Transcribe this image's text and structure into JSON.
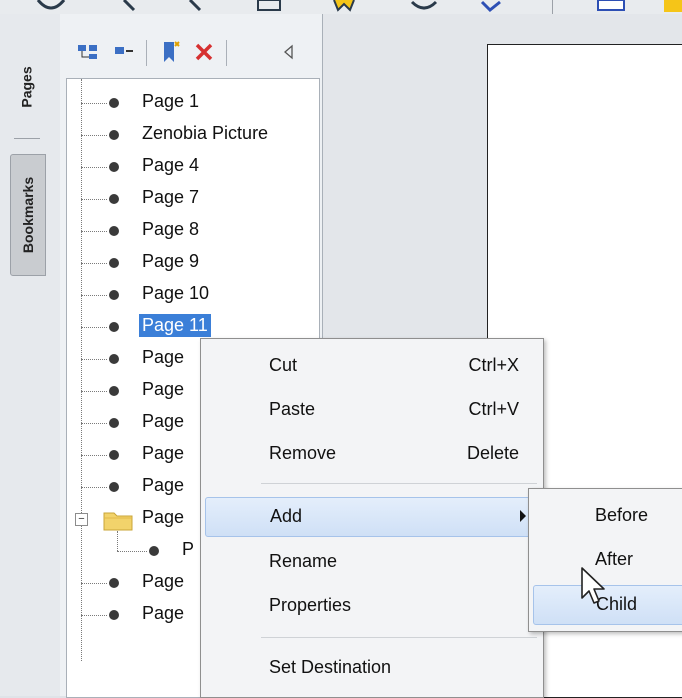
{
  "left_tabs": {
    "pages": "Pages",
    "bookmarks": "Bookmarks"
  },
  "bookmark_tree": {
    "items": [
      {
        "label": "Page 1"
      },
      {
        "label": "Zenobia Picture"
      },
      {
        "label": "Page 4"
      },
      {
        "label": "Page 7"
      },
      {
        "label": "Page 8"
      },
      {
        "label": "Page 9"
      },
      {
        "label": "Page 10"
      },
      {
        "label": "Page 11",
        "selected": true
      },
      {
        "label": "Page"
      },
      {
        "label": "Page"
      },
      {
        "label": "Page"
      },
      {
        "label": "Page"
      },
      {
        "label": "Page"
      },
      {
        "label": "Page",
        "folder": true,
        "expanded": true
      },
      {
        "label": "P",
        "child": true
      },
      {
        "label": "Page"
      },
      {
        "label": "Page"
      }
    ]
  },
  "context_menu": {
    "cut": {
      "label": "Cut",
      "shortcut": "Ctrl+X"
    },
    "paste": {
      "label": "Paste",
      "shortcut": "Ctrl+V"
    },
    "remove": {
      "label": "Remove",
      "shortcut": "Delete"
    },
    "add": {
      "label": "Add"
    },
    "rename": {
      "label": "Rename"
    },
    "properties": {
      "label": "Properties"
    },
    "set_destination": {
      "label": "Set Destination"
    }
  },
  "add_submenu": {
    "before": "Before",
    "after": "After",
    "child": "Child"
  },
  "colors": {
    "selection": "#3b7fd8",
    "menu_highlight": "#cfe0f6",
    "folder": "#f2d36b"
  }
}
